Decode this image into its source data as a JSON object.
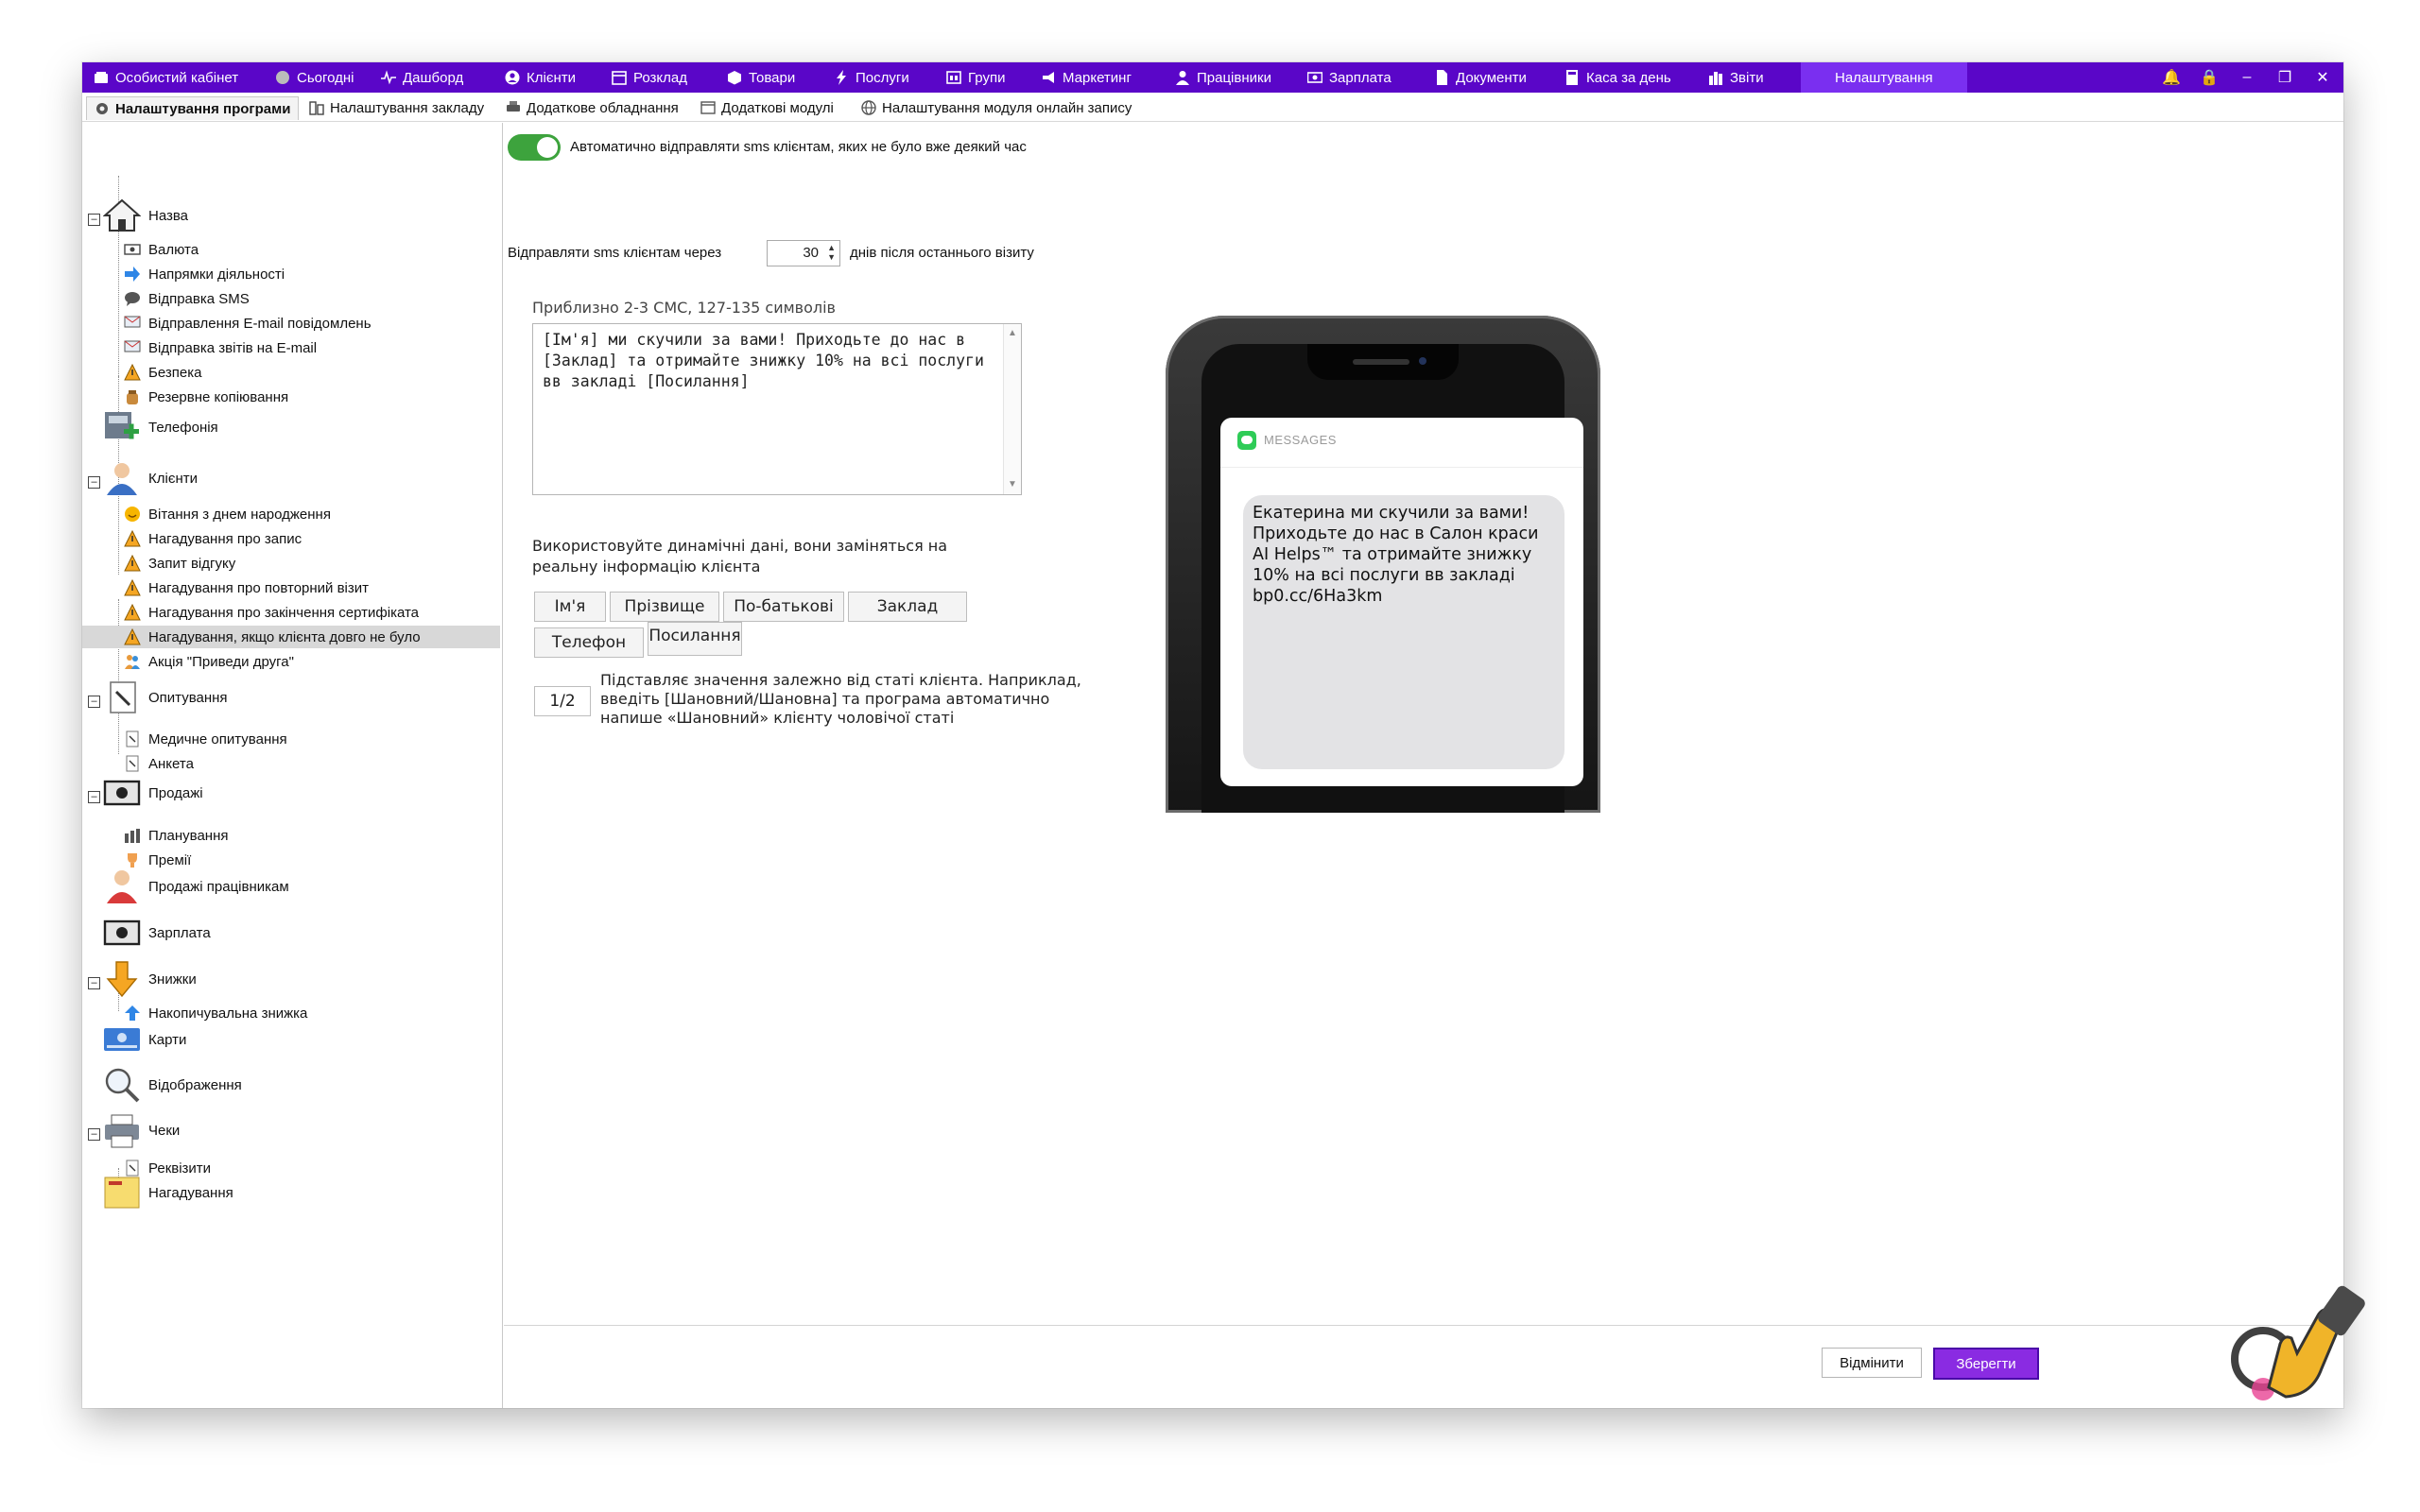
{
  "menu": {
    "items": [
      {
        "label": "Особистий кабінет",
        "icon": "wallet-icon"
      },
      {
        "label": "Сьогодні",
        "icon": "clock-icon"
      },
      {
        "label": "Дашборд",
        "icon": "pulse-icon"
      },
      {
        "label": "Клієнти",
        "icon": "user-circle-icon"
      },
      {
        "label": "Розклад",
        "icon": "calendar-icon"
      },
      {
        "label": "Товари",
        "icon": "box-icon"
      },
      {
        "label": "Послуги",
        "icon": "lightning-icon"
      },
      {
        "label": "Групи",
        "icon": "group-icon"
      },
      {
        "label": "Маркетинг",
        "icon": "megaphone-icon"
      },
      {
        "label": "Працівники",
        "icon": "person-icon"
      },
      {
        "label": "Зарплата",
        "icon": "money-icon"
      },
      {
        "label": "Документи",
        "icon": "document-icon"
      },
      {
        "label": "Каса за день",
        "icon": "calculator-icon"
      },
      {
        "label": "Звіти",
        "icon": "bar-chart-icon"
      },
      {
        "label": "Налаштування",
        "icon": ""
      }
    ],
    "window_controls": [
      "bell-icon",
      "lock-icon",
      "minimize-icon",
      "restore-icon",
      "close-icon"
    ]
  },
  "subtabs": [
    {
      "label": "Налаштування програми",
      "icon": "gear-icon"
    },
    {
      "label": "Налаштування закладу",
      "icon": "building-icon"
    },
    {
      "label": "Додаткове обладнання",
      "icon": "printer-icon"
    },
    {
      "label": "Додаткові модулі",
      "icon": "window-icon"
    },
    {
      "label": "Налаштування модуля онлайн запису",
      "icon": "globe-icon"
    }
  ],
  "tree": {
    "name": "Назва",
    "currency": "Валюта",
    "directions": "Напрямки діяльності",
    "sms": "Відправка SMS",
    "email_notif": "Відправлення E-mail повідомлень",
    "email_reports": "Відправка звітів на E-mail",
    "security": "Безпека",
    "backup": "Резервне копіювання",
    "telephony": "Телефонія",
    "clients": "Клієнти",
    "birthday": "Вітання з днем народження",
    "reminder_appointment": "Нагадування про запис",
    "feedback": "Запит відгуку",
    "repeat_visit": "Нагадування про повторний візит",
    "certificate_end": "Нагадування про закінчення сертифіката",
    "long_absence": "Нагадування, якщо клієнта довго не було",
    "bring_friend": "Акція \"Приведи друга\"",
    "surveys": "Опитування",
    "medical_survey": "Медичне опитування",
    "questionnaire": "Анкета",
    "sales": "Продажі",
    "planning": "Планування",
    "bonuses": "Премії",
    "employee_sales": "Продажі працівникам",
    "salary": "Зарплата",
    "discounts": "Знижки",
    "cumulative_discount": "Накопичувальна знижка",
    "cards": "Карти",
    "display": "Відображення",
    "receipts": "Чеки",
    "requisites": "Реквізити",
    "reminders": "Нагадування"
  },
  "settings": {
    "auto_send_label": "Автоматично відправляти sms клієнтам, яких не було вже деякий час",
    "auto_send_enabled": true,
    "send_after_label": "Відправляти sms клієнтам через",
    "days_value": "30",
    "days_suffix": "днів після останнього візиту",
    "sms_estimate": "Приблизно 2-3 СМС, 127-135 символів",
    "message_template": "[Ім'я] ми скучили за вами! Приходьте до нас в [Заклад] та отримайте знижку 10% на всі послуги вв закладі [Посилання]",
    "dynamic_hint_line1": "Використовуйте динамічні дані, вони заміняться на",
    "dynamic_hint_line2": "реальну інформацію клієнта",
    "tags": [
      "Ім'я",
      "Прізвище",
      "По-батькові",
      "Заклад",
      "Телефон",
      "Посилання"
    ],
    "gender_button": "1/2",
    "gender_hint": "Підставляє значення залежно від статі клієнта. Наприклад, введіть [Шановний/Шановна] та програма автоматично напише «Шановний» клієнту чоловічої статі"
  },
  "preview": {
    "app_name": "MESSAGES",
    "message": "Екатерина ми скучили за вами! Приходьте до нас в Салон краси AI Helps™ та отримайте знижку 10% на всі послуги вв закладі bp0.cc/6Ha3km"
  },
  "actions": {
    "cancel": "Відмінити",
    "save": "Зберегти"
  },
  "colors": {
    "accent": "#5a06c8",
    "active_tab": "#7a2ff0",
    "toggle_on": "#3da33d",
    "save_button": "#8a2be2"
  }
}
